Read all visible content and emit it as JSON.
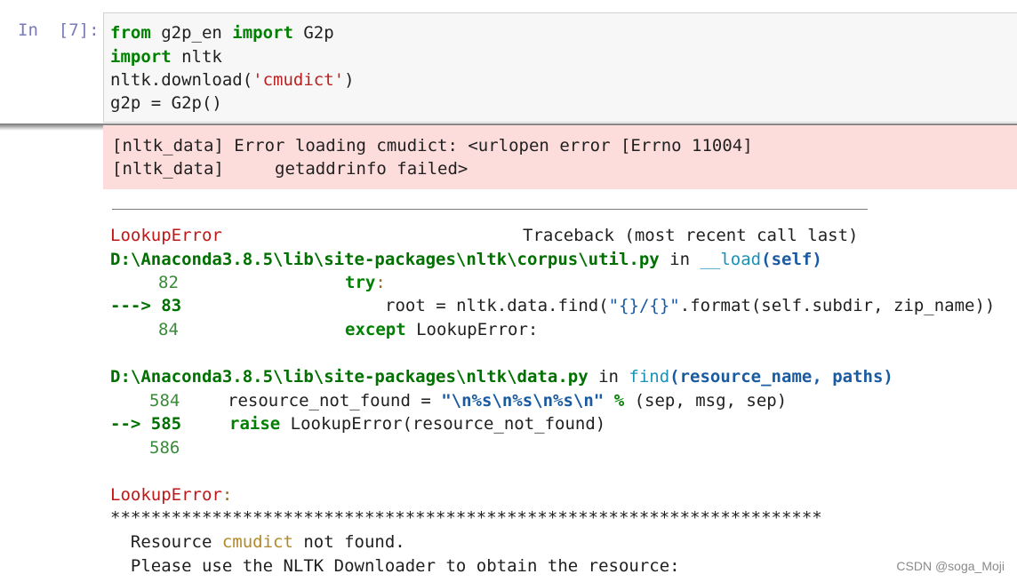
{
  "prompt": "In  [7]:",
  "code": {
    "line1": {
      "kw1": "from",
      "mod": " g2p_en ",
      "kw2": "import",
      "name": " G2p"
    },
    "line2": {
      "kw": "import",
      "rest": " nltk"
    },
    "line3": {
      "pre": "nltk.download(",
      "str": "'cmudict'",
      "post": ")"
    },
    "line4": "g2p = G2p()"
  },
  "stderr": [
    "[nltk_data] Error loading cmudict: <urlopen error [Errno 11004]",
    "[nltk_data]     getaddrinfo failed>"
  ],
  "traceback": {
    "error_name": "LookupError",
    "header": "Traceback (most recent call last)",
    "frame1": {
      "path": "D:\\Anaconda3.8.5\\lib\\site-packages\\nltk\\corpus\\util.py",
      "in_word": " in ",
      "func": "__load",
      "args": "(self)",
      "l82_num": "82",
      "l82_code": "try",
      "l82_colon": ":",
      "l83_arrow": "---> 83",
      "l83_pre": "root = nltk.data.find(",
      "l83_str": "\"{}/{}\"",
      "l83_post": ".format(self.subdir, zip_name))",
      "l84_num": "84",
      "l84_kw": "except",
      "l84_rest": " LookupError:"
    },
    "frame2": {
      "path": "D:\\Anaconda3.8.5\\lib\\site-packages\\nltk\\data.py",
      "in_word": " in ",
      "func": "find",
      "args": "(resource_name, paths)",
      "l584_num": "584",
      "l584_pre": "resource_not_found = ",
      "l584_str": "\"\\n%s\\n%s\\n%s\\n\"",
      "l584_op": " % ",
      "l584_post": "(sep, msg, sep)",
      "l585_arrow": "--> 585",
      "l585_kw": "raise",
      "l585_rest": " LookupError(resource_not_found)",
      "l586_num": "586"
    },
    "final_error": "LookupError",
    "final_colon": ":",
    "stars": "**********************************************************************",
    "msg1_pre": "  Resource ",
    "msg1_res": "cmudict",
    "msg1_post": " not found.",
    "msg2": "  Please use the NLTK Downloader to obtain the resource:"
  },
  "watermark": "CSDN @soga_Moji",
  "colors": {
    "keyword": "#008000",
    "string": "#ba2121",
    "error": "#c01818",
    "stderr_bg": "#fddcdc",
    "cell_bg": "#f7f7f7"
  }
}
